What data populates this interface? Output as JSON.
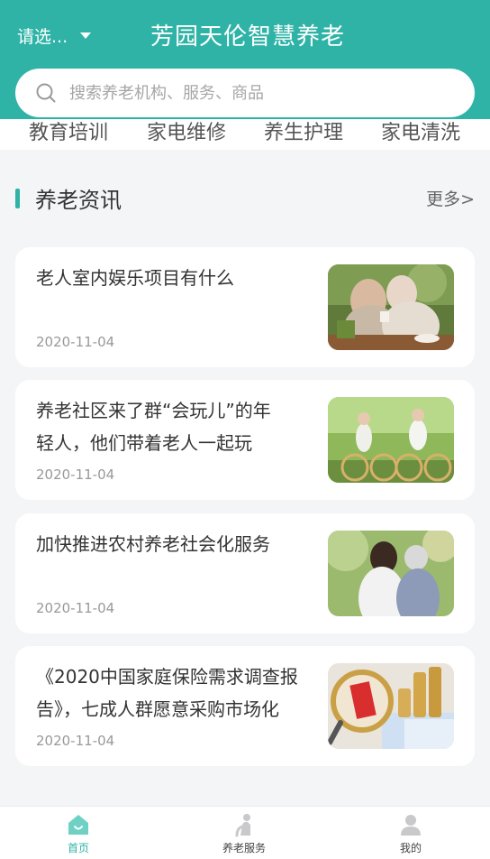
{
  "header": {
    "city_label": "请选...",
    "title": "芳园天伦智慧养老",
    "search_placeholder": "搜索养老机构、服务、商品",
    "bg_color": "#2fb3a6"
  },
  "categories": [
    "教育培训",
    "家电维修",
    "养生护理",
    "家电清洗"
  ],
  "section": {
    "title": "养老资讯",
    "more_label": "更多>"
  },
  "news": [
    {
      "line1": "老人室内娱乐项目有什么",
      "line2": "",
      "date": "2020-11-04",
      "image": "elderly-couple-tea-photo"
    },
    {
      "line1": "养老社区来了群“会玩儿”的年",
      "line2": "轻人，他们带着老人一起玩",
      "date": "2020-11-04",
      "image": "elderly-cycling-photo"
    },
    {
      "line1": "加快推进农村养老社会化服务",
      "line2": "",
      "date": "2020-11-04",
      "image": "caregiver-with-elder-photo"
    },
    {
      "line1": "《2020中国家庭保险需求调查报",
      "line2": "告》，七成人群愿意采购市场化",
      "date": "2020-11-04",
      "image": "social-insurance-magnifier-photo"
    }
  ],
  "tabbar": {
    "home": {
      "label": "首页",
      "icon": "home-icon"
    },
    "service": {
      "label": "养老服务",
      "icon": "elder-service-icon"
    },
    "mine": {
      "label": "我的",
      "icon": "person-icon"
    },
    "active_color": "#2fb3a6"
  }
}
